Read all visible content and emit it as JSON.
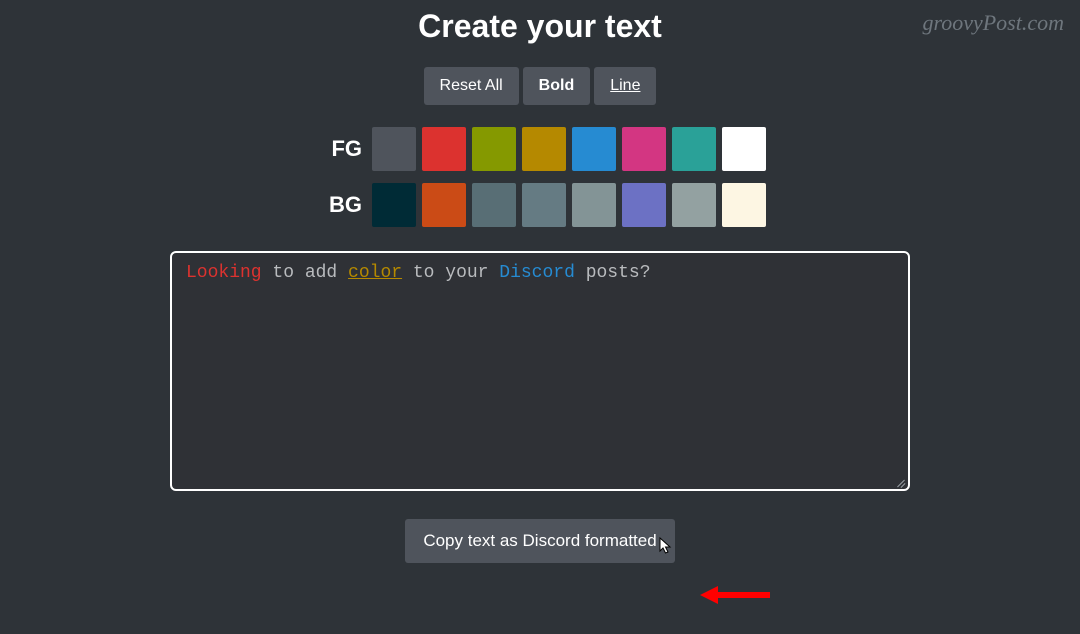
{
  "watermark": "groovyPost.com",
  "heading": "Create your text",
  "toolbar": {
    "reset_label": "Reset All",
    "bold_label": "Bold",
    "line_label": "Line"
  },
  "fg": {
    "label": "FG",
    "colors": [
      "#4f545c",
      "#dc322f",
      "#859900",
      "#b58900",
      "#268bd2",
      "#d33682",
      "#2aa198",
      "#ffffff"
    ]
  },
  "bg": {
    "label": "BG",
    "colors": [
      "#002b36",
      "#cb4b16",
      "#586e75",
      "#657b83",
      "#839496",
      "#6c71c4",
      "#93a1a1",
      "#fdf6e3"
    ]
  },
  "editor": {
    "tokens": [
      {
        "text": "Looking",
        "color": "#dc322f",
        "underline": false
      },
      {
        "text": " to add ",
        "color": "#b9bbbe",
        "underline": false
      },
      {
        "text": "color",
        "color": "#b58900",
        "underline": true
      },
      {
        "text": " to your ",
        "color": "#b9bbbe",
        "underline": false
      },
      {
        "text": "Discord",
        "color": "#268bd2",
        "underline": false
      },
      {
        "text": " posts?",
        "color": "#b9bbbe",
        "underline": false
      }
    ]
  },
  "copy_button_label": "Copy text as Discord formatted"
}
